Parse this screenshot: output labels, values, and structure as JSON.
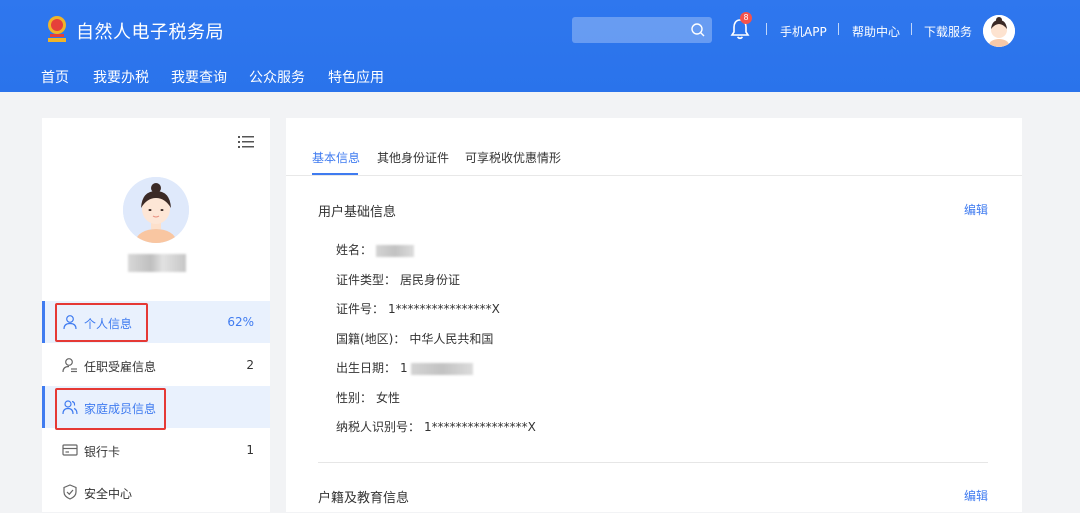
{
  "header": {
    "site_title": "自然人电子税务局",
    "bell_badge": "8",
    "links": [
      "手机APP",
      "帮助中心",
      "下载服务"
    ],
    "accent_color": "#2f77ee"
  },
  "nav": [
    "首页",
    "我要办税",
    "我要查询",
    "公众服务",
    "特色应用"
  ],
  "sidebar": {
    "items": [
      {
        "label": "个人信息",
        "count": "62%",
        "icon": "user-icon",
        "active": true
      },
      {
        "label": "任职受雇信息",
        "count": "2",
        "icon": "user-list-icon",
        "active": false
      },
      {
        "label": "家庭成员信息",
        "count": "",
        "icon": "family-icon",
        "active": true
      },
      {
        "label": "银行卡",
        "count": "1",
        "icon": "bank-card-icon",
        "active": false
      },
      {
        "label": "安全中心",
        "count": "",
        "icon": "shield-icon",
        "active": false
      }
    ]
  },
  "tabs": [
    "基本信息",
    "其他身份证件",
    "可享税收优惠情形"
  ],
  "basic_info": {
    "title": "用户基础信息",
    "edit": "编辑",
    "fields": [
      {
        "label": "姓名：",
        "value": ""
      },
      {
        "label": "证件类型：",
        "value": "居民身份证"
      },
      {
        "label": "证件号：",
        "value": "1****************X"
      },
      {
        "label": "国籍(地区)：",
        "value": "中华人民共和国"
      },
      {
        "label": "出生日期：",
        "value": "1"
      },
      {
        "label": "性别：",
        "value": "女性"
      },
      {
        "label": "纳税人识别号：",
        "value": "1****************X"
      }
    ]
  },
  "residence_info": {
    "title": "户籍及教育信息",
    "edit": "编辑"
  }
}
